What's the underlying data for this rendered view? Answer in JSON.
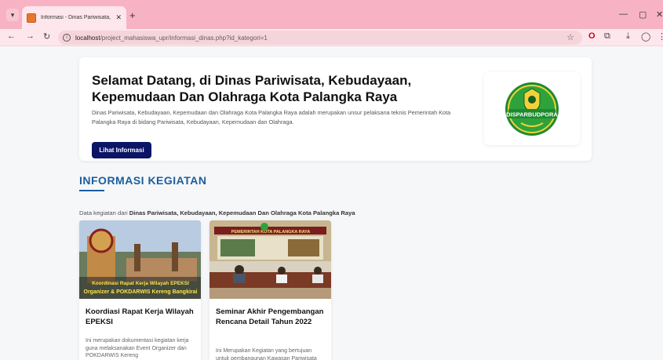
{
  "browser": {
    "tab_title": "Informasi - Dinas Pariwisata, Ke",
    "tab_close": "✕",
    "new_tab": "+",
    "url_host": "localhost",
    "url_path": "/project_mahasiswa_upr/informasi_dinas.php?id_kategori=1"
  },
  "hero": {
    "title": "Selamat Datang, di Dinas Pariwisata, Kebudayaan, Kepemudaan Dan Olahraga Kota Palangka Raya",
    "description": "Dinas Pariwisata, Kebudayaan, Kepemudaan dan Olahraga Kota Palangka Raya adalah merupakan unsur pelaksana teknis Pemerintah Kota Palangka Raya di bidang Pariwisata, Kebudayaan, Kepemudaan dan Olahraga.",
    "button_label": "Lihat Informasi",
    "logo_text": "DISPARBUDPORA"
  },
  "section": {
    "title": "INFORMASI KEGIATAN",
    "desc_prefix": "Data kegiatan dari ",
    "desc_bold": "Dinas Pariwisata, Kebudayaan, Kepemudaan Dan Olahraga Kota Palangka Raya"
  },
  "cards": [
    {
      "image_caption_1": "Koordinasi Rapat Kerja Wilayah EPEKSI",
      "image_caption_2": "Organizer & POKDARWIS Kereng Bangkirai",
      "title": "Koordiasi Rapat Kerja Wilayah EPEKSI",
      "description": "Ini merupakan dokumentasi kegiatan kerja guna melaksanakan Event Organizer dan POKDARWIS Kereng"
    },
    {
      "image_banner": "PEMERINTAH KOTA PALANGKA RAYA",
      "title": "Seminar Akhir Pengembangan Rencana Detail Tahun 2022",
      "description": "Ini Merupakan Kegiatan yang bertujuan untuk pembangunan Kawasan Pariwisata"
    }
  ],
  "colors": {
    "tab_strip": "#f7b3c4",
    "toolbar": "#fde7ec",
    "primary_button": "#0c1466",
    "section_title": "#1a5e9c"
  }
}
